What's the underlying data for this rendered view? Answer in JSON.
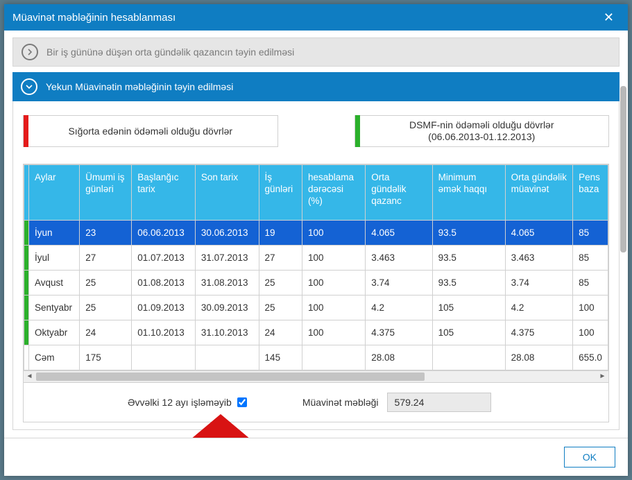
{
  "dialog_title": "Müavinət məbləğinin hesablanması",
  "section_collapsed": {
    "label": "Bir iş gününə düşən orta gündəlik qazancın təyin edilməsi"
  },
  "section_expanded": {
    "label": "Yekun Müavinətin məbləğinin təyin edilməsi"
  },
  "periods": {
    "insurer": "Sığorta edənin ödəməli olduğu dövrlər",
    "dsmf_line1": "DSMF-nin ödəməli olduğu dövrlər",
    "dsmf_line2": "(06.06.2013-01.12.2013)"
  },
  "table": {
    "headers": {
      "month": "Aylar",
      "total_days": "Ümumi iş günləri",
      "start_date": "Başlanğıc tarix",
      "end_date": "Son tarix",
      "work_days": "İş günləri",
      "rate": "hesablama dərəcəsi (%)",
      "avg_daily": "Orta gündəlik qazanc",
      "min_wage": "Minimum əmək haqqı",
      "avg_benefit": "Orta gündəlik müavinət",
      "pension": "Pens baza"
    },
    "rows": [
      {
        "month": "İyun",
        "total": "23",
        "start": "06.06.2013",
        "end": "30.06.2013",
        "work": "19",
        "rate": "100",
        "avg": "4.065",
        "min": "93.5",
        "ben": "4.065",
        "pens": "85",
        "stripe": "green",
        "selected": true
      },
      {
        "month": "İyul",
        "total": "27",
        "start": "01.07.2013",
        "end": "31.07.2013",
        "work": "27",
        "rate": "100",
        "avg": "3.463",
        "min": "93.5",
        "ben": "3.463",
        "pens": "85",
        "stripe": "green"
      },
      {
        "month": "Avqust",
        "total": "25",
        "start": "01.08.2013",
        "end": "31.08.2013",
        "work": "25",
        "rate": "100",
        "avg": "3.74",
        "min": "93.5",
        "ben": "3.74",
        "pens": "85",
        "stripe": "green"
      },
      {
        "month": "Sentyabr",
        "total": "25",
        "start": "01.09.2013",
        "end": "30.09.2013",
        "work": "25",
        "rate": "100",
        "avg": "4.2",
        "min": "105",
        "ben": "4.2",
        "pens": "100",
        "stripe": "green"
      },
      {
        "month": "Oktyabr",
        "total": "24",
        "start": "01.10.2013",
        "end": "31.10.2013",
        "work": "24",
        "rate": "100",
        "avg": "4.375",
        "min": "105",
        "ben": "4.375",
        "pens": "100",
        "stripe": "green"
      }
    ],
    "sum": {
      "label": "Cəm",
      "total": "175",
      "work": "145",
      "avg": "28.08",
      "ben": "28.08",
      "pens": "655.0"
    }
  },
  "bottom": {
    "prev12_label": "Əvvəlki 12 ayı işləməyib",
    "prev12_checked": true,
    "amount_label": "Müavinət məbləği",
    "amount_value": "579.24"
  },
  "ok_label": "OK"
}
